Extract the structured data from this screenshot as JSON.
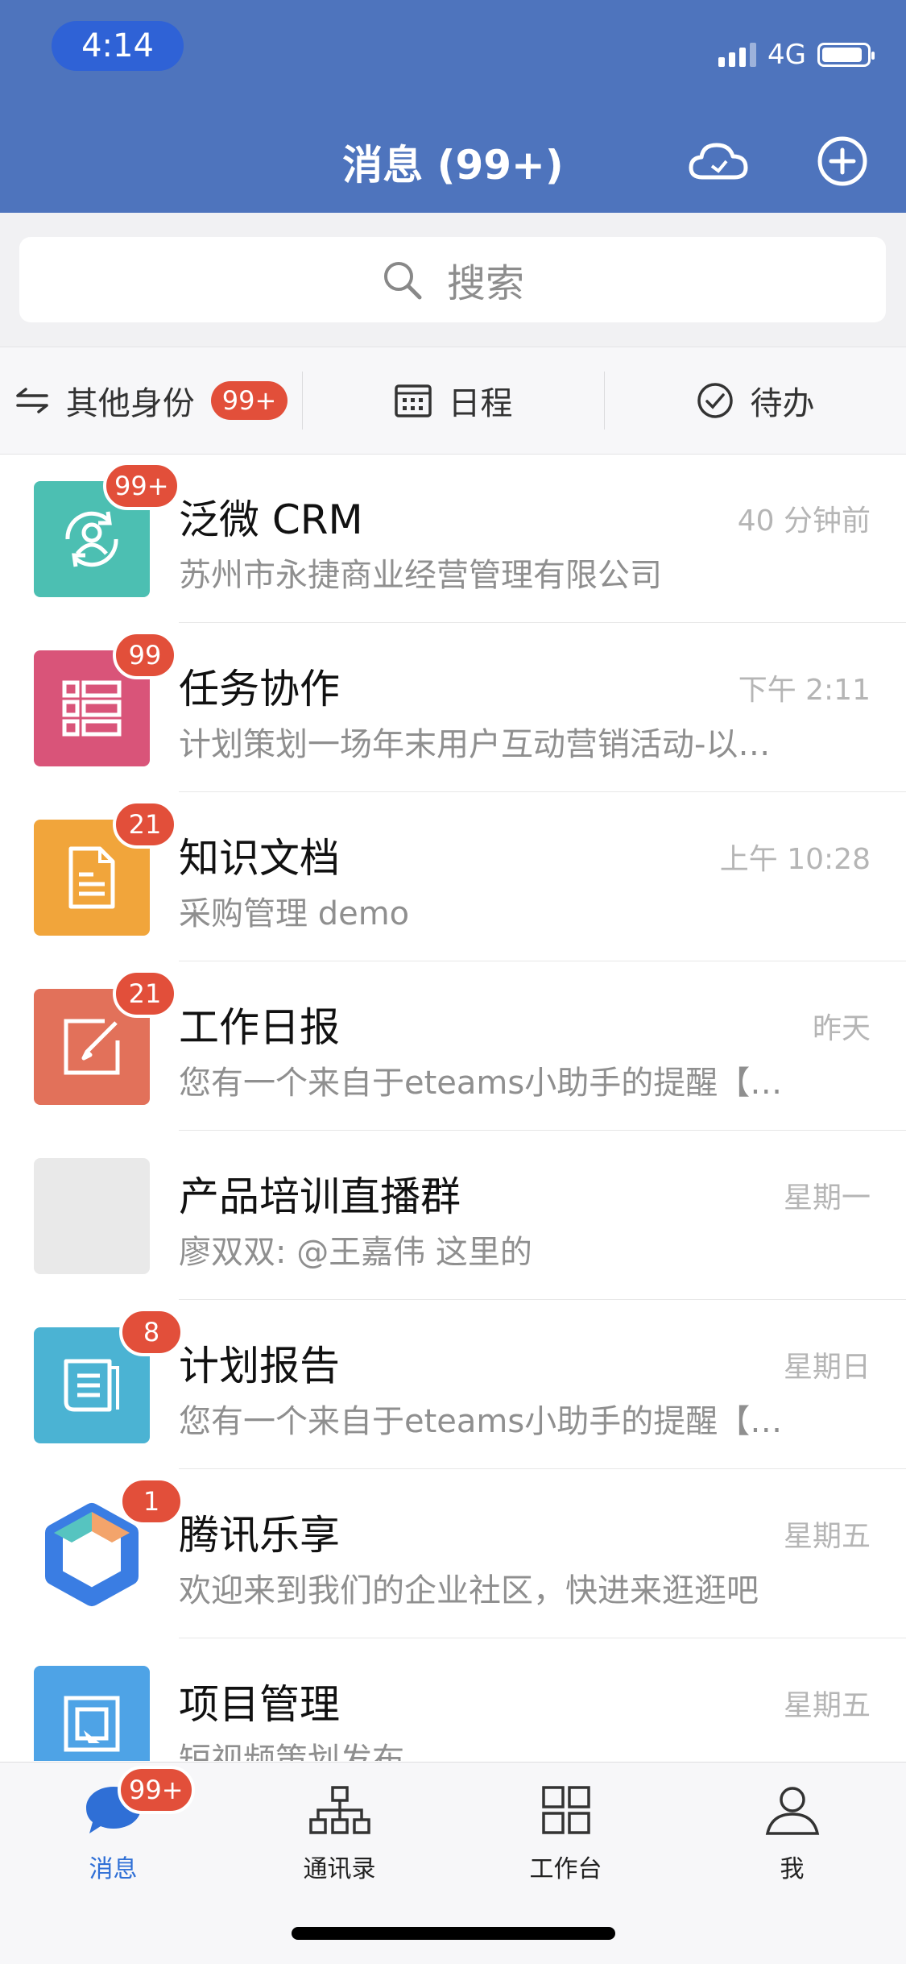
{
  "status_bar": {
    "time": "4:14",
    "network": "4G",
    "signal_bars": 4,
    "battery_level": 0.9
  },
  "header": {
    "title": "消息 (99+)",
    "icons": [
      "cloud-icon",
      "add-circle-icon"
    ]
  },
  "search": {
    "placeholder": "搜索"
  },
  "subbar": {
    "identity": {
      "label": "其他身份",
      "badge": "99+"
    },
    "schedule": {
      "label": "日程"
    },
    "todo": {
      "label": "待办"
    }
  },
  "colors": {
    "header_bg": "#4e74bd",
    "badge": "#e24f3a",
    "tab_active": "#2f6fd6"
  },
  "messages": [
    {
      "name": "泛微 CRM",
      "preview": "苏州市永捷商业经营管理有限公司",
      "time": "40 分钟前",
      "badge": "99+",
      "icon": "crm-person-icon",
      "color": "#4cbfb2"
    },
    {
      "name": "任务协作",
      "preview": "计划策划一场年末用户互动营销活动-以…",
      "time": "下午 2:11",
      "badge": "99",
      "icon": "task-list-icon",
      "color": "#d95479"
    },
    {
      "name": "知识文档",
      "preview": "采购管理 demo",
      "time": "上午 10:28",
      "badge": "21",
      "icon": "document-icon",
      "color": "#f1a53b"
    },
    {
      "name": "工作日报",
      "preview": "您有一个来自于eteams小助手的提醒【…",
      "time": "昨天",
      "badge": "21",
      "icon": "edit-icon",
      "color": "#e2715a"
    },
    {
      "name": "产品培训直播群",
      "preview": "廖双双: @王嘉伟 这里的",
      "time": "星期一",
      "badge": "",
      "icon": "group-avatar-icon",
      "color": "#e9e9e9"
    },
    {
      "name": "计划报告",
      "preview": "您有一个来自于eteams小助手的提醒【…",
      "time": "星期日",
      "badge": "8",
      "icon": "report-icon",
      "color": "#4bb3d3"
    },
    {
      "name": "腾讯乐享",
      "preview": "欢迎来到我们的企业社区，快进来逛逛吧",
      "time": "星期五",
      "badge": "1",
      "icon": "lexiang-logo-icon",
      "color": "#ffffff"
    },
    {
      "name": "项目管理",
      "preview": "短视频策划发布",
      "time": "星期五",
      "badge": "",
      "icon": "project-icon",
      "color": "#4ea3e6"
    }
  ],
  "tabbar": {
    "tabs": [
      {
        "label": "消息",
        "icon": "chat-bubble-icon",
        "badge": "99+",
        "active": true
      },
      {
        "label": "通讯录",
        "icon": "org-chart-icon",
        "badge": "",
        "active": false
      },
      {
        "label": "工作台",
        "icon": "grid-icon",
        "badge": "",
        "active": false
      },
      {
        "label": "我",
        "icon": "person-icon",
        "badge": "",
        "active": false
      }
    ]
  }
}
